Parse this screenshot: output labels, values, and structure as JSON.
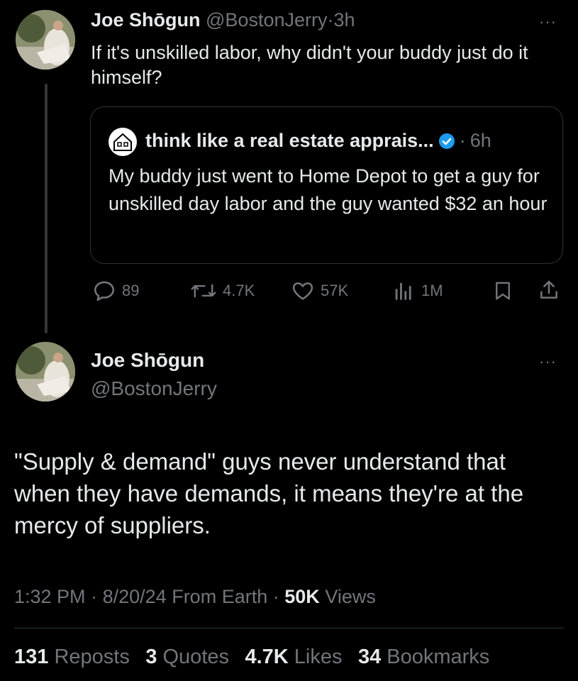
{
  "reply_tweet": {
    "display_name": "Joe Shōgun",
    "handle": "@BostonJerry",
    "separator": "·",
    "time": "3h",
    "more": "···",
    "text": "If it's unskilled labor, why didn't your buddy just do it himself?"
  },
  "quoted_tweet": {
    "display_name": "think like a real estate apprais...",
    "verified": true,
    "separator": "·",
    "time": "6h",
    "text": "My buddy just went to Home Depot to get a guy for unskilled day labor and the guy wanted $32 an hour"
  },
  "actions": {
    "replies": "89",
    "reposts": "4.7K",
    "likes": "57K",
    "views": "1M"
  },
  "main_tweet": {
    "display_name": "Joe Shōgun",
    "handle": "@BostonJerry",
    "more": "···",
    "text": "\"Supply & demand\" guys never understand that when they have demands, it means they're at the mercy of suppliers.",
    "time": "1:32 PM",
    "date": "8/20/24",
    "source": "From Earth",
    "views_count": "50K",
    "views_label": "Views",
    "sep": "·"
  },
  "stats": {
    "reposts_count": "131",
    "reposts_label": "Reposts",
    "quotes_count": "3",
    "quotes_label": "Quotes",
    "likes_count": "4.7K",
    "likes_label": "Likes",
    "bookmarks_count": "34",
    "bookmarks_label": "Bookmarks"
  },
  "colors": {
    "background": "#000000",
    "text": "#e7e9ea",
    "secondary": "#71767b",
    "verified": "#1d9bf0",
    "border": "#2f3336"
  }
}
